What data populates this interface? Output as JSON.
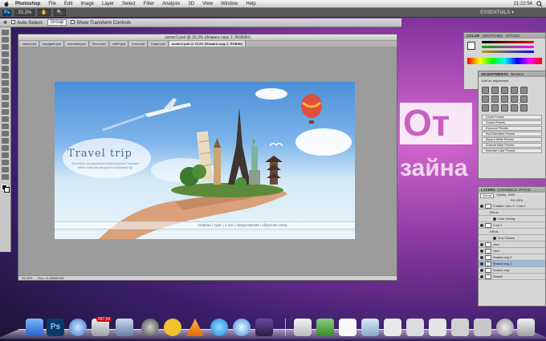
{
  "menubar": {
    "app": "Photoshop",
    "items": [
      "File",
      "Edit",
      "Image",
      "Layer",
      "Select",
      "Filter",
      "Analysis",
      "3D",
      "View",
      "Window",
      "Help"
    ],
    "clock": "21:22:54"
  },
  "appbar": {
    "logo": "Ps",
    "zoom": "33,3%",
    "workspace": "ESSENTIALS ▾"
  },
  "options": {
    "auto_select": "Auto-Select:",
    "group": "Group",
    "transform": "Show Transform Controls"
  },
  "document": {
    "title": "sumer2.psd @ 33,3% (Фомага серу 2, RGB/8#)",
    "tabs": [
      "мини.psd",
      "сандрий.psd",
      "колонна.psd",
      "Фото.psd",
      "лобб.psd",
      "плот.psd",
      "Скаут.psd",
      "sumer2.psd @ 33,3% (Фомага серу 2, RGB/8#)"
    ],
    "status_zoom": "33,33%",
    "status_doc": "Doc: 11,0M/80,0M"
  },
  "artwork": {
    "title": "Travel trip",
    "tagline": "Велкомем, мы решим все ваши вопросы! Поможем найти наиболее выгодный и красивый тур",
    "nav": "главная  |  туры  |  о нас  |  предложения  |  обратная связь"
  },
  "panels": {
    "color": "COLOR",
    "swatches": "SWATCHES",
    "styles": "STYLES",
    "adjustments": "ADJUSTMENTS",
    "masks": "MASKS",
    "add_adjustment": "Add an adjustment",
    "presets": [
      "Levels Presets",
      "Curves Presets",
      "Exposure Presets",
      "Hue/Saturation Presets",
      "Black & White Presets",
      "Channel Mixer Presets",
      "Selective Color Presets"
    ],
    "layers": "LAYERS",
    "channels": "CHANNELS",
    "paths": "PATHS",
    "blend": "Normal",
    "opacity": "Opacity: 100%",
    "fill": "Fill: 100%",
    "layer_rows": [
      "Сливает / serv 2 / Слои 1",
      "Effects",
      "Color Overlay",
      "Слои 1",
      "Effects",
      "Drop Shadow",
      "текст",
      "текст",
      "Фомага серу 3",
      "Фомага серу 2",
      "Фомага серу",
      "Фомага"
    ]
  },
  "desktop": {
    "big1": "От",
    "big2": "зайна"
  },
  "dock": {
    "badge": "597,54"
  },
  "colors": {
    "accent": "#0b3a66",
    "sky": "#4b8fd8",
    "desktop_pink": "#d86bd0"
  }
}
